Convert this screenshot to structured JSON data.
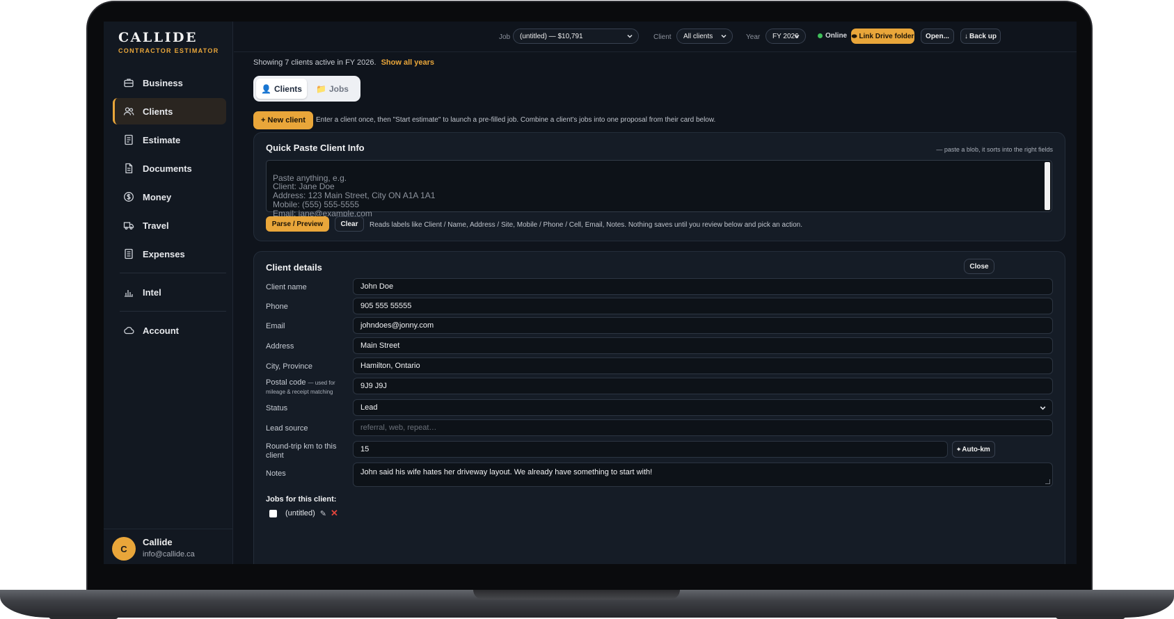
{
  "brand": {
    "title": "CALLIDE",
    "subtitle": "CONTRACTOR ESTIMATOR"
  },
  "sidebar": {
    "items": [
      {
        "label": "Business",
        "icon": "briefcase-icon"
      },
      {
        "label": "Clients",
        "icon": "users-icon",
        "active": true
      },
      {
        "label": "Estimate",
        "icon": "estimate-icon"
      },
      {
        "label": "Documents",
        "icon": "document-icon"
      },
      {
        "label": "Money",
        "icon": "dollar-icon"
      },
      {
        "label": "Travel",
        "icon": "truck-icon"
      },
      {
        "label": "Expenses",
        "icon": "receipt-icon"
      },
      {
        "label": "Intel",
        "icon": "bar-chart-icon"
      },
      {
        "label": "Account",
        "icon": "cloud-icon"
      }
    ],
    "user": {
      "initial": "C",
      "name": "Callide",
      "email": "info@callide.ca"
    }
  },
  "topbar": {
    "job_label": "Job",
    "job_value": "(untitled) — $10,791",
    "client_label": "Client",
    "client_value": "All clients",
    "year_label": "Year",
    "year_value": "FY 2026",
    "status": "Online",
    "link_drive": "Link Drive folder",
    "open": "Open...",
    "backup": "Back up"
  },
  "main": {
    "showing_text": "Showing 7 clients active in FY 2026.",
    "show_all": "Show all years",
    "tabs": [
      "Clients",
      "Jobs"
    ],
    "new_client": "+ New client",
    "hint": "Enter a client once, then \"Start estimate\" to launch a pre-filled job. Combine a client's jobs into one proposal from their card below."
  },
  "quick_paste": {
    "title": "Quick Paste Client Info",
    "note": "— paste a blob, it sorts into the right fields",
    "placeholder": "Paste anything, e.g.\nClient: Jane Doe\nAddress: 123 Main Street, City ON A1A 1A1\nMobile: (555) 555-5555\nEmail: jane@example.com",
    "parse_button": "Parse / Preview",
    "clear_button": "Clear",
    "help": "Reads labels like Client / Name, Address / Site, Mobile / Phone / Cell, Email, Notes. Nothing saves until you review below and pick an action."
  },
  "client_details": {
    "title": "Client details",
    "close": "Close",
    "fields": {
      "name": {
        "label": "Client name",
        "value": "John Doe"
      },
      "phone": {
        "label": "Phone",
        "value": "905 555 55555"
      },
      "email": {
        "label": "Email",
        "value": "johndoes@jonny.com"
      },
      "address": {
        "label": "Address",
        "value": "Main Street"
      },
      "city": {
        "label": "City, Province",
        "value": "Hamilton, Ontario"
      },
      "postal": {
        "label": "Postal code",
        "sublabel": "— used for mileage & receipt matching",
        "value": "9J9 J9J"
      },
      "status": {
        "label": "Status",
        "value": "Lead"
      },
      "lead_source": {
        "label": "Lead source",
        "placeholder": "referral, web, repeat…"
      },
      "km": {
        "label": "Round-trip km to this client",
        "value": "15",
        "button": "Auto-km"
      },
      "notes": {
        "label": "Notes",
        "value": "John said his wife hates her driveway layout. We already have something to start with!"
      }
    },
    "jobs_title": "Jobs for this client:",
    "jobs": [
      {
        "label": "(untitled)"
      }
    ]
  },
  "colors": {
    "accent": "#e9a63a",
    "background": "#0f141c",
    "online": "#3fbf5a",
    "delete": "#e2453c"
  }
}
